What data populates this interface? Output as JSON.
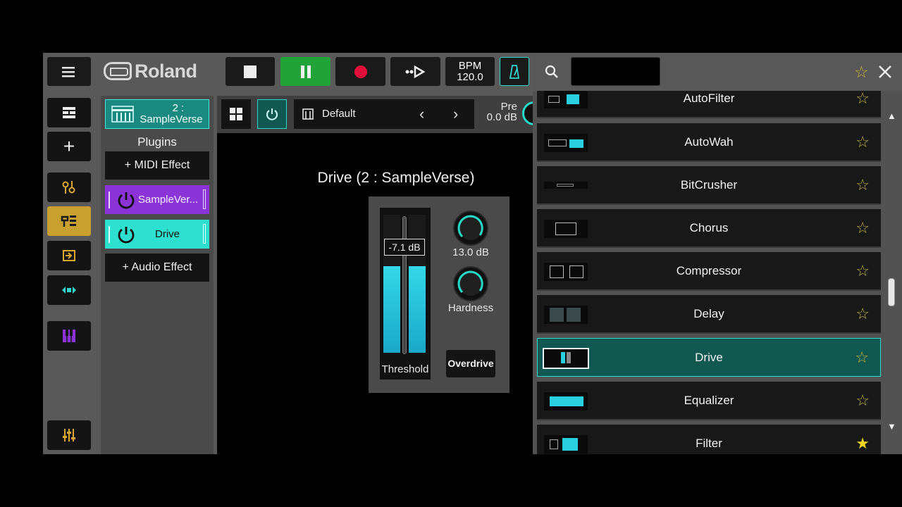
{
  "topbar": {
    "brand": "Roland",
    "bpm_label": "BPM",
    "bpm_value": "120.0"
  },
  "plugins_panel": {
    "track_number": "2 :",
    "track_name": "SampleVerse",
    "heading": "Plugins",
    "add_midi_label": "+ MIDI Effect",
    "instrument_label": "SampleVer...",
    "effect_label": "Drive",
    "add_audio_label": "+ Audio Effect"
  },
  "editor": {
    "preset_name": "Default",
    "pre_label": "Pre",
    "pre_value": "0.0 dB",
    "title": "Drive (2 : SampleVerse)",
    "threshold_value": "-7.1 dB",
    "threshold_label": "Threshold",
    "threshold_level": 0.63,
    "knob1_value": "13.0 dB",
    "knob2_label": "Hardness",
    "overdrive_label": "Overdrive"
  },
  "browser": {
    "search_value": "",
    "effects": [
      {
        "name": "AutoFilter",
        "favorite": false
      },
      {
        "name": "AutoWah",
        "favorite": false
      },
      {
        "name": "BitCrusher",
        "favorite": false
      },
      {
        "name": "Chorus",
        "favorite": false
      },
      {
        "name": "Compressor",
        "favorite": false
      },
      {
        "name": "Delay",
        "favorite": false
      },
      {
        "name": "Drive",
        "favorite": false,
        "selected": true
      },
      {
        "name": "Equalizer",
        "favorite": false
      },
      {
        "name": "Filter",
        "favorite": true
      }
    ]
  },
  "colors": {
    "accent_teal": "#26d9c8",
    "record_red": "#e0103a",
    "play_green": "#22a33a",
    "instrument_purple": "#8a33d6",
    "sidebar_gold": "#c8a030",
    "star_gold": "#d4c030"
  },
  "icons": {
    "menu": "menu-icon",
    "stop": "stop-icon",
    "pause": "pause-icon",
    "record": "record-icon",
    "skip": "skip-forward-icon",
    "metronome": "metronome-icon",
    "search": "search-icon",
    "close": "close-icon",
    "star": "star-icon"
  }
}
